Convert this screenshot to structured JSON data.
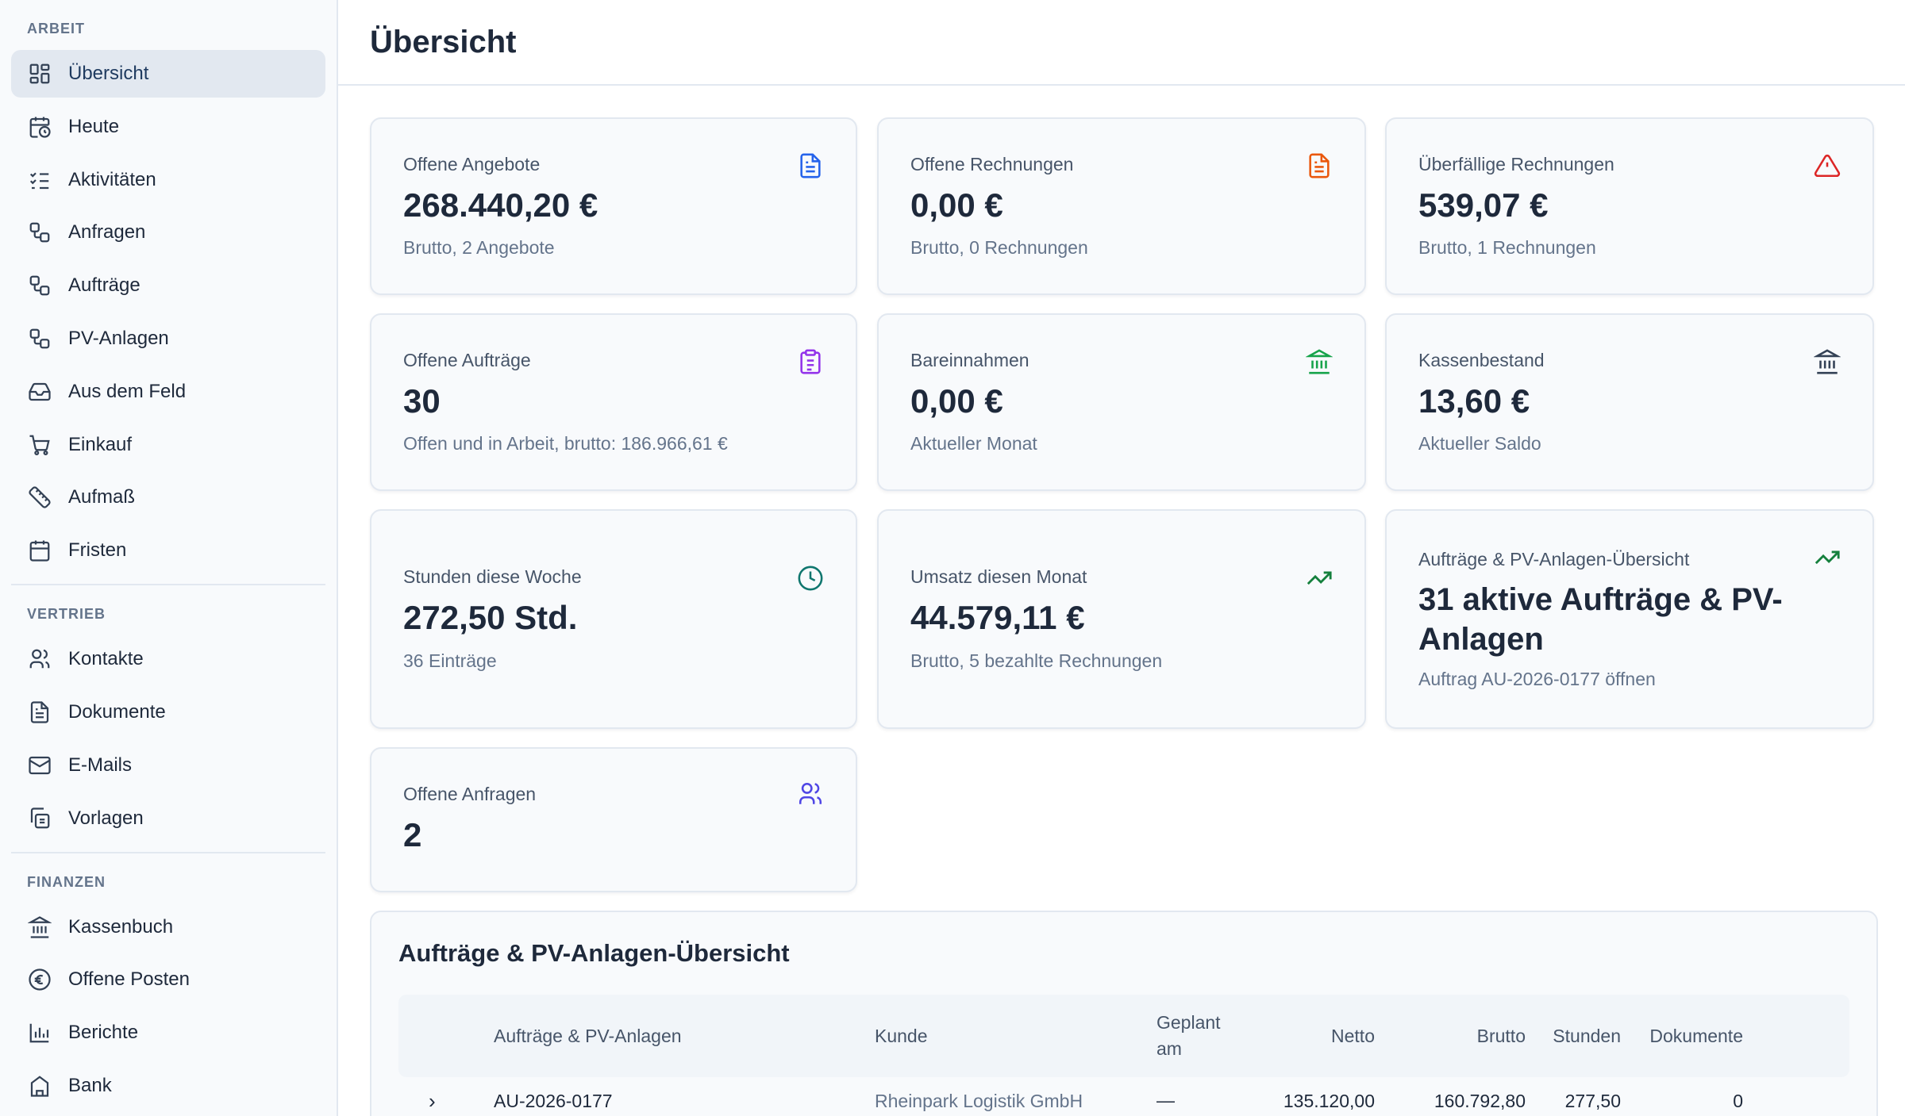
{
  "sidebar": {
    "sections": [
      {
        "label": "ARBEIT",
        "items": [
          {
            "label": "Übersicht",
            "icon": "dashboard-icon",
            "active": true
          },
          {
            "label": "Heute",
            "icon": "calendar-clock-icon"
          },
          {
            "label": "Aktivitäten",
            "icon": "list-checks-icon"
          },
          {
            "label": "Anfragen",
            "icon": "workflow-icon"
          },
          {
            "label": "Aufträge",
            "icon": "workflow-icon"
          },
          {
            "label": "PV-Anlagen",
            "icon": "workflow-icon"
          },
          {
            "label": "Aus dem Feld",
            "icon": "inbox-icon"
          },
          {
            "label": "Einkauf",
            "icon": "cart-icon"
          },
          {
            "label": "Aufmaß",
            "icon": "ruler-icon"
          },
          {
            "label": "Fristen",
            "icon": "calendar-icon"
          }
        ]
      },
      {
        "label": "VERTRIEB",
        "items": [
          {
            "label": "Kontakte",
            "icon": "users-icon"
          },
          {
            "label": "Dokumente",
            "icon": "document-icon"
          },
          {
            "label": "E-Mails",
            "icon": "mail-icon"
          },
          {
            "label": "Vorlagen",
            "icon": "copy-icon"
          }
        ]
      },
      {
        "label": "FINANZEN",
        "items": [
          {
            "label": "Kassenbuch",
            "icon": "bank-icon"
          },
          {
            "label": "Offene Posten",
            "icon": "euro-icon"
          },
          {
            "label": "Berichte",
            "icon": "bar-chart-icon"
          },
          {
            "label": "Bank",
            "icon": "building-icon"
          }
        ]
      }
    ]
  },
  "header": {
    "title": "Übersicht"
  },
  "cards": {
    "offene_angebote": {
      "title": "Offene Angebote",
      "value": "268.440,20 €",
      "sub": "Brutto, 2 Angebote",
      "icon": "file-text-icon",
      "color": "#2563eb"
    },
    "offene_rechnungen": {
      "title": "Offene Rechnungen",
      "value": "0,00 €",
      "sub": "Brutto, 0 Rechnungen",
      "icon": "file-text-icon",
      "color": "#ea580c"
    },
    "ueberfaellige_rechnungen": {
      "title": "Überfällige Rechnungen",
      "value": "539,07 €",
      "sub": "Brutto, 1 Rechnungen",
      "icon": "alert-triangle-icon",
      "color": "#dc2626"
    },
    "offene_auftraege": {
      "title": "Offene Aufträge",
      "value": "30",
      "sub": "Offen und in Arbeit, brutto: 186.966,61 €",
      "icon": "clipboard-icon",
      "color": "#9333ea"
    },
    "bareinnahmen": {
      "title": "Bareinnahmen",
      "value": "0,00 €",
      "sub": "Aktueller Monat",
      "icon": "bank-icon",
      "color": "#16a34a"
    },
    "kassenbestand": {
      "title": "Kassenbestand",
      "value": "13,60 €",
      "sub": "Aktueller Saldo",
      "icon": "bank-icon",
      "color": "#334155"
    },
    "stunden": {
      "title": "Stunden diese Woche",
      "value": "272,50 Std.",
      "sub": "36 Einträge",
      "icon": "clock-icon",
      "color": "#0f766e"
    },
    "umsatz": {
      "title": "Umsatz diesen Monat",
      "value": "44.579,11 €",
      "sub": "Brutto, 5 bezahlte Rechnungen",
      "icon": "trending-up-icon",
      "color": "#15803d"
    },
    "auftraege_uebersicht": {
      "title": "Aufträge & PV-Anlagen-Übersicht",
      "value": "31 aktive Aufträge & PV-Anlagen",
      "sub": "Auftrag AU-2026-0177 öffnen",
      "icon": "trending-up-icon",
      "color": "#15803d"
    },
    "offene_anfragen": {
      "title": "Offene Anfragen",
      "value": "2",
      "icon": "users-icon",
      "color": "#4f46e5"
    }
  },
  "table": {
    "title": "Aufträge & PV-Anlagen-Übersicht",
    "headers": {
      "name": "Aufträge & PV-Anlagen",
      "kunde": "Kunde",
      "geplant": "Geplant am",
      "netto": "Netto",
      "brutto": "Brutto",
      "stunden": "Stunden",
      "dokumente": "Dokumente"
    },
    "rows": [
      {
        "expand": "›",
        "name": "AU-2026-0177",
        "kunde": "Rheinpark Logistik GmbH",
        "geplant": "—",
        "netto": "135.120,00",
        "brutto": "160.792,80",
        "stunden": "277,50",
        "dokumente": "0"
      }
    ]
  }
}
